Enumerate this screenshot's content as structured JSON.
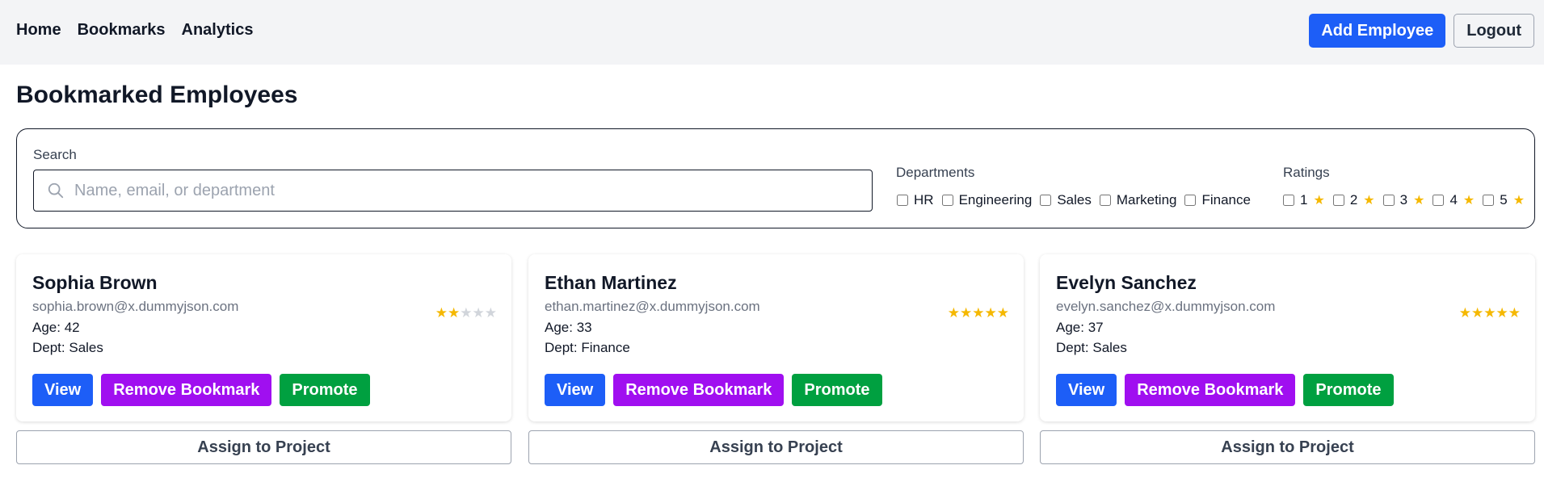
{
  "nav": {
    "home": "Home",
    "bookmarks": "Bookmarks",
    "analytics": "Analytics"
  },
  "actions": {
    "add_employee": "Add Employee",
    "logout": "Logout"
  },
  "page": {
    "title": "Bookmarked Employees"
  },
  "filters": {
    "search_label": "Search",
    "search_placeholder": "Name, email, or department",
    "search_value": "",
    "departments_label": "Departments",
    "departments": [
      "HR",
      "Engineering",
      "Sales",
      "Marketing",
      "Finance"
    ],
    "ratings_label": "Ratings",
    "ratings": [
      "1",
      "2",
      "3",
      "4",
      "5"
    ]
  },
  "cards": [
    {
      "name": "Sophia Brown",
      "email": "sophia.brown@x.dummyjson.com",
      "age": "Age: 42",
      "dept": "Dept: Sales",
      "rating": 2,
      "view": "View",
      "remove": "Remove Bookmark",
      "promote": "Promote",
      "assign": "Assign to Project"
    },
    {
      "name": "Ethan Martinez",
      "email": "ethan.martinez@x.dummyjson.com",
      "age": "Age: 33",
      "dept": "Dept: Finance",
      "rating": 5,
      "view": "View",
      "remove": "Remove Bookmark",
      "promote": "Promote",
      "assign": "Assign to Project"
    },
    {
      "name": "Evelyn Sanchez",
      "email": "evelyn.sanchez@x.dummyjson.com",
      "age": "Age: 37",
      "dept": "Dept: Sales",
      "rating": 5,
      "view": "View",
      "remove": "Remove Bookmark",
      "promote": "Promote",
      "assign": "Assign to Project"
    }
  ],
  "colors": {
    "primary": "#1d5ef7",
    "remove": "#a00ff0",
    "promote": "#00a040",
    "star": "#f5b800",
    "star_empty": "#d1d5db"
  }
}
